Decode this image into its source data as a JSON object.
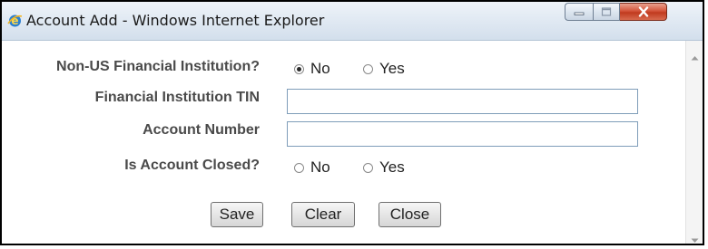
{
  "window": {
    "title": "Account Add - Windows Internet Explorer",
    "icon": "internet-explorer-icon",
    "controls": [
      "minimize-icon",
      "maximize-icon",
      "close-icon"
    ]
  },
  "form": {
    "non_us": {
      "label": "Non-US Financial Institution?",
      "options": [
        {
          "label": "No",
          "checked": true
        },
        {
          "label": "Yes",
          "checked": false
        }
      ]
    },
    "tin": {
      "label": "Financial Institution TIN",
      "value": ""
    },
    "account_number": {
      "label": "Account Number",
      "value": ""
    },
    "closed": {
      "label": "Is Account Closed?",
      "options": [
        {
          "label": "No",
          "checked": false
        },
        {
          "label": "Yes",
          "checked": false
        }
      ]
    }
  },
  "buttons": {
    "save": "Save",
    "clear": "Clear",
    "close": "Close"
  }
}
